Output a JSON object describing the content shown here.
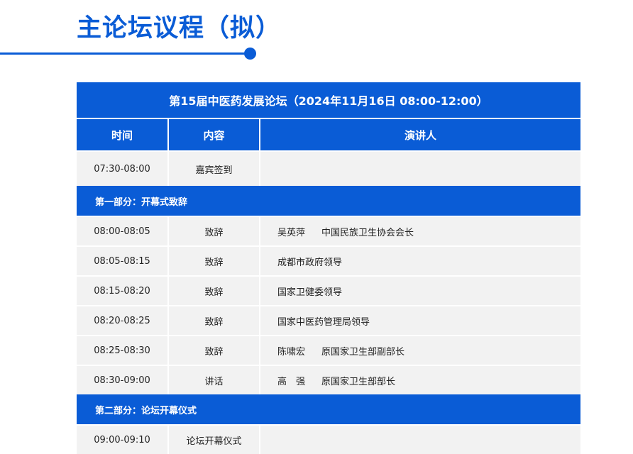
{
  "heading": "主论坛议程（拟）",
  "colors": {
    "accent": "#0a5cd6",
    "row_bg": "#f2f2f2",
    "text": "#222222"
  },
  "forum_banner": "第15届中医药发展论坛（2024年11月16日  08:00-12:00）",
  "columns": {
    "time": "时间",
    "content": "内容",
    "speaker": "演讲人"
  },
  "checkin": {
    "time": "07:30-08:00",
    "content": "嘉宾签到",
    "speaker": ""
  },
  "part1": {
    "title": "第一部分：开幕式致辞",
    "rows": [
      {
        "time": "08:00-08:05",
        "content": "致辞",
        "name": "吴英萍",
        "title": "中国民族卫生协会会长"
      },
      {
        "time": "08:05-08:15",
        "content": "致辞",
        "name": "成都市政府领导",
        "title": ""
      },
      {
        "time": "08:15-08:20",
        "content": "致辞",
        "name": "国家卫健委领导",
        "title": ""
      },
      {
        "time": "08:20-08:25",
        "content": "致辞",
        "name": "国家中医药管理局领导",
        "title": ""
      },
      {
        "time": "08:25-08:30",
        "content": "致辞",
        "name": "陈啸宏",
        "title": "原国家卫生部副部长"
      },
      {
        "time": "08:30-09:00",
        "content": "讲话",
        "name": "高　强",
        "title": "原国家卫生部部长"
      }
    ]
  },
  "part2": {
    "title": "第二部分：论坛开幕仪式",
    "rows": [
      {
        "time": "09:00-09:10",
        "content": "论坛开幕仪式",
        "speaker": ""
      }
    ]
  }
}
